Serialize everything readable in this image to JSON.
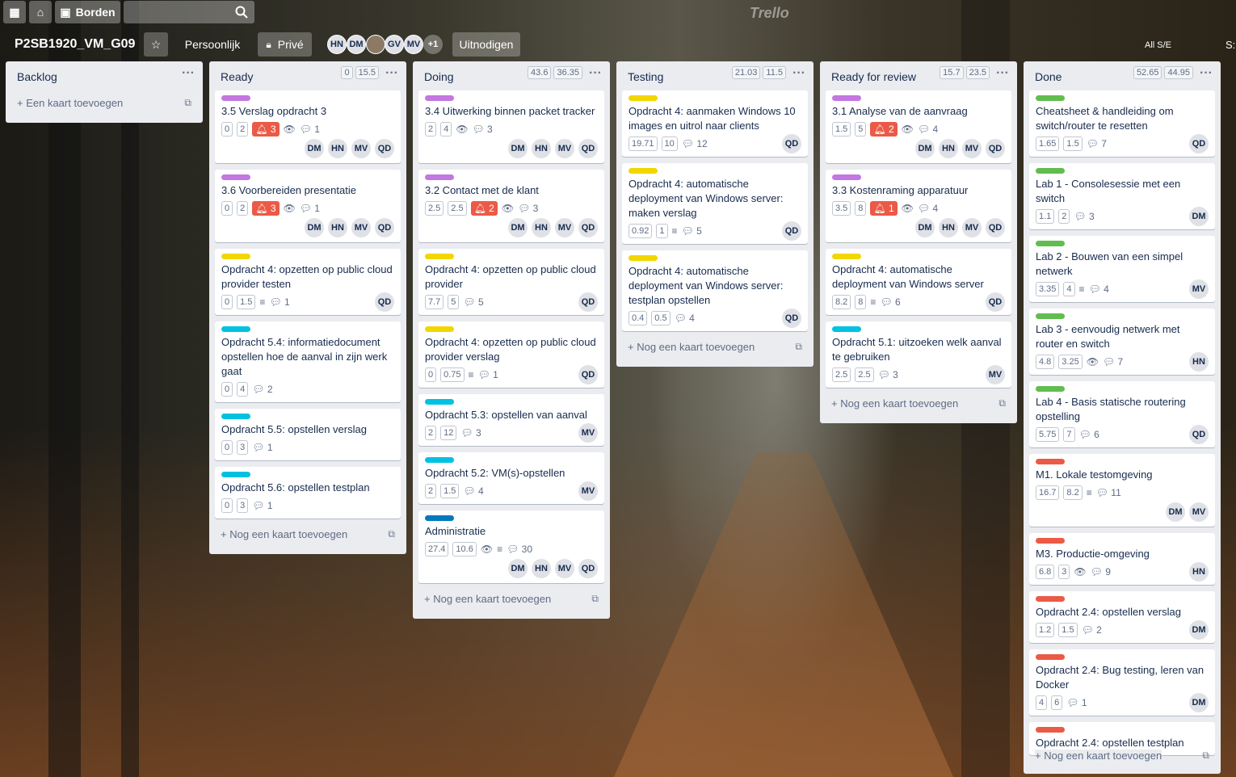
{
  "topbar": {
    "home_label": "",
    "boards_label": "Borden",
    "search_placeholder": "",
    "logo": "Trello"
  },
  "board": {
    "name": "P2SB1920_VM_G09",
    "team": "Persoonlijk",
    "visibility": "Privé",
    "members": [
      "HN",
      "DM",
      "",
      "GV",
      "MV"
    ],
    "more_members": "+1",
    "invite": "Uitnodigen",
    "right_label": "All S/E",
    "right_label2": "S:"
  },
  "lists": [
    {
      "title": "Backlog",
      "badges": [],
      "add": "Een kaart toevoegen",
      "cards": []
    },
    {
      "title": "Ready",
      "badges": [
        "0",
        "15.5"
      ],
      "add": "Nog een kaart toevoegen",
      "cards": [
        {
          "color": "#c377e0",
          "title": "3.5 Verslag opdracht 3",
          "nums": [
            "0",
            "2"
          ],
          "alert": "3",
          "watch": true,
          "desc": false,
          "comments": "1",
          "members": [
            "DM",
            "HN",
            "MV",
            "QD"
          ]
        },
        {
          "color": "#c377e0",
          "title": "3.6 Voorbereiden presentatie",
          "nums": [
            "0",
            "2"
          ],
          "alert": "3",
          "watch": true,
          "desc": false,
          "comments": "1",
          "members": [
            "DM",
            "HN",
            "MV",
            "QD"
          ]
        },
        {
          "color": "#f2d600",
          "title": "Opdracht 4: opzetten op public cloud provider testen",
          "nums": [
            "0",
            "1.5"
          ],
          "alert": "",
          "watch": false,
          "desc": true,
          "comments": "1",
          "members": [
            "QD"
          ]
        },
        {
          "color": "#00c2e0",
          "title": "Opdracht 5.4: informatiedocument opstellen hoe de aanval in zijn werk gaat",
          "nums": [
            "0",
            "4"
          ],
          "alert": "",
          "watch": false,
          "desc": false,
          "comments": "2",
          "members": []
        },
        {
          "color": "#00c2e0",
          "title": "Opdracht 5.5: opstellen verslag",
          "nums": [
            "0",
            "3"
          ],
          "alert": "",
          "watch": false,
          "desc": false,
          "comments": "1",
          "members": []
        },
        {
          "color": "#00c2e0",
          "title": "Opdracht 5.6: opstellen testplan",
          "nums": [
            "0",
            "3"
          ],
          "alert": "",
          "watch": false,
          "desc": false,
          "comments": "1",
          "members": []
        }
      ]
    },
    {
      "title": "Doing",
      "badges": [
        "43.6",
        "36.35"
      ],
      "add": "Nog een kaart toevoegen",
      "cards": [
        {
          "color": "#c377e0",
          "title": "3.4 Uitwerking binnen packet tracker",
          "nums": [
            "2",
            "4"
          ],
          "alert": "",
          "watch": true,
          "desc": false,
          "comments": "3",
          "members": [
            "DM",
            "HN",
            "MV",
            "QD"
          ]
        },
        {
          "color": "#c377e0",
          "title": "3.2 Contact met de klant",
          "nums": [
            "2.5",
            "2.5"
          ],
          "alert": "2",
          "watch": true,
          "desc": false,
          "comments": "3",
          "members": [
            "DM",
            "HN",
            "MV",
            "QD"
          ]
        },
        {
          "color": "#f2d600",
          "title": "Opdracht 4: opzetten op public cloud provider",
          "nums": [
            "7.7",
            "5"
          ],
          "alert": "",
          "watch": false,
          "desc": false,
          "comments": "5",
          "members": [
            "QD"
          ]
        },
        {
          "color": "#f2d600",
          "title": "Opdracht 4: opzetten op public cloud provider verslag",
          "nums": [
            "0",
            "0.75"
          ],
          "alert": "",
          "watch": false,
          "desc": true,
          "comments": "1",
          "members": [
            "QD"
          ]
        },
        {
          "color": "#00c2e0",
          "title": "Opdracht 5.3: opstellen van aanval",
          "nums": [
            "2",
            "12"
          ],
          "alert": "",
          "watch": false,
          "desc": false,
          "comments": "3",
          "members": [
            "MV"
          ]
        },
        {
          "color": "#00c2e0",
          "title": "Opdracht 5.2: VM(s)-opstellen",
          "nums": [
            "2",
            "1.5"
          ],
          "alert": "",
          "watch": false,
          "desc": false,
          "comments": "4",
          "members": [
            "MV"
          ]
        },
        {
          "color": "#0079bf",
          "title": "Administratie",
          "nums": [
            "27.4",
            "10.6"
          ],
          "alert": "",
          "watch": true,
          "desc": true,
          "comments": "30",
          "members": [
            "DM",
            "HN",
            "MV",
            "QD"
          ]
        }
      ]
    },
    {
      "title": "Testing",
      "badges": [
        "21.03",
        "11.5"
      ],
      "add": "Nog een kaart toevoegen",
      "cards": [
        {
          "color": "#f2d600",
          "title": "Opdracht 4: aanmaken Windows 10 images en uitrol naar clients",
          "nums": [
            "19.71",
            "10"
          ],
          "alert": "",
          "watch": false,
          "desc": false,
          "comments": "12",
          "members": [
            "QD"
          ]
        },
        {
          "color": "#f2d600",
          "title": "Opdracht 4: automatische deployment van Windows server: maken verslag",
          "nums": [
            "0.92",
            "1"
          ],
          "alert": "",
          "watch": false,
          "desc": true,
          "comments": "5",
          "members": [
            "QD"
          ]
        },
        {
          "color": "#f2d600",
          "title": "Opdracht 4: automatische deployment van Windows server: testplan opstellen",
          "nums": [
            "0.4",
            "0.5"
          ],
          "alert": "",
          "watch": false,
          "desc": false,
          "comments": "4",
          "members": [
            "QD"
          ]
        }
      ]
    },
    {
      "title": "Ready for review",
      "badges": [
        "15.7",
        "23.5"
      ],
      "add": "Nog een kaart toevoegen",
      "cards": [
        {
          "color": "#c377e0",
          "title": "3.1 Analyse van de aanvraag",
          "nums": [
            "1.5",
            "5"
          ],
          "alert": "2",
          "watch": true,
          "desc": false,
          "comments": "4",
          "members": [
            "DM",
            "HN",
            "MV",
            "QD"
          ]
        },
        {
          "color": "#c377e0",
          "title": "3.3 Kostenraming apparatuur",
          "nums": [
            "3.5",
            "8"
          ],
          "alert": "1",
          "watch": true,
          "desc": false,
          "comments": "4",
          "members": [
            "DM",
            "HN",
            "MV",
            "QD"
          ]
        },
        {
          "color": "#f2d600",
          "title": "Opdracht 4: automatische deployment van Windows server",
          "nums": [
            "8.2",
            "8"
          ],
          "alert": "",
          "watch": false,
          "desc": true,
          "comments": "6",
          "members": [
            "QD"
          ]
        },
        {
          "color": "#00c2e0",
          "title": "Opdracht 5.1: uitzoeken welk aanval te gebruiken",
          "nums": [
            "2.5",
            "2.5"
          ],
          "alert": "",
          "watch": false,
          "desc": false,
          "comments": "3",
          "members": [
            "MV"
          ]
        }
      ]
    },
    {
      "title": "Done",
      "badges": [
        "52.65",
        "44.95"
      ],
      "add": "Nog een kaart toevoegen",
      "cards": [
        {
          "color": "#61bd4f",
          "title": "Cheatsheet & handleiding om switch/router te resetten",
          "nums": [
            "1.65",
            "1.5"
          ],
          "alert": "",
          "watch": false,
          "desc": false,
          "comments": "7",
          "members": [
            "QD"
          ]
        },
        {
          "color": "#61bd4f",
          "title": "Lab 1 - Consolesessie met een switch",
          "nums": [
            "1.1",
            "2"
          ],
          "alert": "",
          "watch": false,
          "desc": false,
          "comments": "3",
          "members": [
            "DM"
          ]
        },
        {
          "color": "#61bd4f",
          "title": "Lab 2 - Bouwen van een simpel netwerk",
          "nums": [
            "3.35",
            "4"
          ],
          "alert": "",
          "watch": false,
          "desc": true,
          "comments": "4",
          "members": [
            "MV"
          ]
        },
        {
          "color": "#61bd4f",
          "title": "Lab 3 - eenvoudig netwerk met router en switch",
          "nums": [
            "4.8",
            "3.25"
          ],
          "alert": "",
          "watch": true,
          "desc": false,
          "comments": "7",
          "members": [
            "HN"
          ]
        },
        {
          "color": "#61bd4f",
          "title": "Lab 4 - Basis statische routering opstelling",
          "nums": [
            "5.75",
            "7"
          ],
          "alert": "",
          "watch": false,
          "desc": false,
          "comments": "6",
          "members": [
            "QD"
          ]
        },
        {
          "color": "#eb5a46",
          "title": "M1. Lokale testomgeving",
          "nums": [
            "16.7",
            "8.2"
          ],
          "alert": "",
          "watch": false,
          "desc": true,
          "comments": "11",
          "members": [
            "DM",
            "MV"
          ]
        },
        {
          "color": "#eb5a46",
          "title": "M3. Productie-omgeving",
          "nums": [
            "6.8",
            "3"
          ],
          "alert": "",
          "watch": true,
          "desc": false,
          "comments": "9",
          "members": [
            "HN"
          ]
        },
        {
          "color": "#eb5a46",
          "title": "Opdracht 2.4: opstellen verslag",
          "nums": [
            "1.2",
            "1.5"
          ],
          "alert": "",
          "watch": false,
          "desc": false,
          "comments": "2",
          "members": [
            "DM"
          ]
        },
        {
          "color": "#eb5a46",
          "title": "Opdracht 2.4: Bug testing, leren van Docker",
          "nums": [
            "4",
            "6"
          ],
          "alert": "",
          "watch": false,
          "desc": false,
          "comments": "1",
          "members": [
            "DM"
          ]
        },
        {
          "color": "#eb5a46",
          "title": "Opdracht 2.4: opstellen testplan",
          "nums": [],
          "alert": "",
          "watch": false,
          "desc": false,
          "comments": "",
          "members": []
        }
      ]
    }
  ]
}
